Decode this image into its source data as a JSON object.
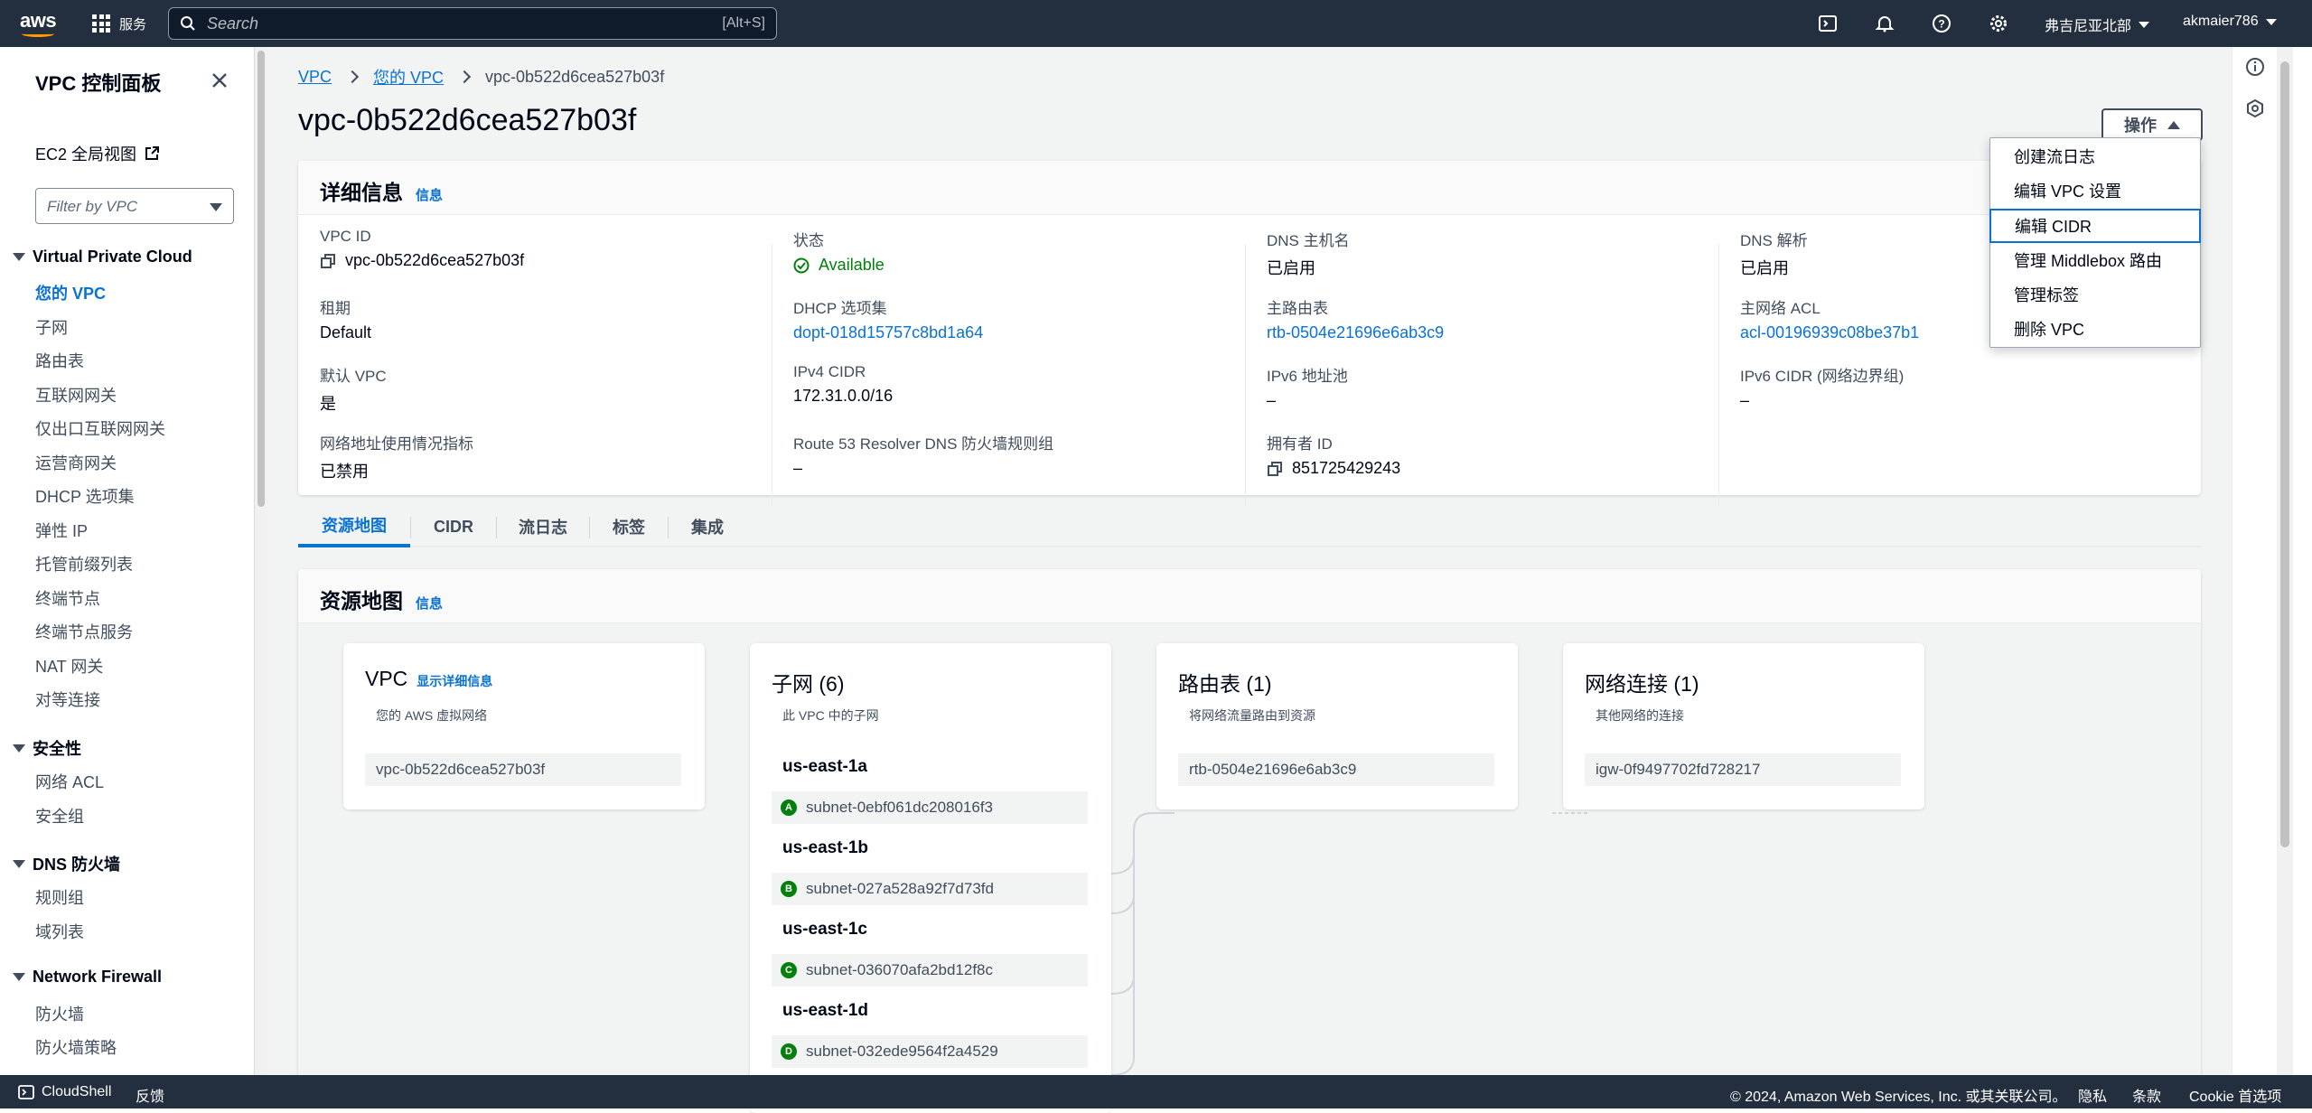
{
  "topbar": {
    "logo": "aws",
    "services_label": "服务",
    "search_placeholder": "Search",
    "search_shortcut": "[Alt+S]",
    "region": "弗吉尼亚北部",
    "user": "akmaier786",
    "icons": [
      "cloudshell-icon",
      "bell-icon",
      "help-icon",
      "settings-icon"
    ]
  },
  "sidenav": {
    "title": "VPC 控制面板",
    "ec2_link": "EC2 全局视图",
    "filter_placeholder": "Filter by VPC",
    "sections": [
      {
        "title": "Virtual Private Cloud",
        "items": [
          "您的 VPC",
          "子网",
          "路由表",
          "互联网网关",
          "仅出口互联网网关",
          "运营商网关",
          "DHCP 选项集",
          "弹性 IP",
          "托管前缀列表",
          "终端节点",
          "终端节点服务",
          "NAT 网关",
          "对等连接"
        ]
      },
      {
        "title": "安全性",
        "items": [
          "网络 ACL",
          "安全组"
        ]
      },
      {
        "title": "DNS 防火墙",
        "items": [
          "规则组",
          "域列表"
        ]
      },
      {
        "title": "Network Firewall",
        "items": [
          "防火墙",
          "防火墙策略"
        ]
      }
    ],
    "active_item": "您的 VPC"
  },
  "breadcrumb": {
    "items": [
      "VPC",
      "您的 VPC",
      "vpc-0b522d6cea527b03f"
    ]
  },
  "page_title": "vpc-0b522d6cea527b03f",
  "actions_label": "操作",
  "actions_menu": [
    "创建流日志",
    "编辑 VPC 设置",
    "编辑 CIDR",
    "管理 Middlebox 路由",
    "管理标签",
    "删除 VPC"
  ],
  "actions_focused": "编辑 CIDR",
  "details": {
    "title": "详细信息",
    "info": "信息",
    "fields": [
      {
        "label": "VPC ID",
        "value": "vpc-0b522d6cea527b03f"
      },
      {
        "label": "状态",
        "value": "Available"
      },
      {
        "label": "DNS 主机名",
        "value": "已启用"
      },
      {
        "label": "DNS 解析",
        "value": "已启用"
      },
      {
        "label": "租期",
        "value": "Default"
      },
      {
        "label": "DHCP 选项集",
        "value": "dopt-018d15757c8bd1a64"
      },
      {
        "label": "主路由表",
        "value": "rtb-0504e21696e6ab3c9"
      },
      {
        "label": "主网络 ACL",
        "value": "acl-00196939c08be37b1"
      },
      {
        "label": "默认 VPC",
        "value": "是"
      },
      {
        "label": "IPv4 CIDR",
        "value": "172.31.0.0/16"
      },
      {
        "label": "IPv6 地址池",
        "value": "–"
      },
      {
        "label": "IPv6 CIDR (网络边界组)",
        "value": "–"
      },
      {
        "label": "网络地址使用情况指标",
        "value": "已禁用"
      },
      {
        "label": "Route 53 Resolver DNS 防火墙规则组",
        "value": "–"
      },
      {
        "label": "拥有者 ID",
        "value": "851725429243"
      }
    ]
  },
  "tabs": [
    "资源地图",
    "CIDR",
    "流日志",
    "标签",
    "集成"
  ],
  "active_tab": "资源地图",
  "resource_map": {
    "title": "资源地图",
    "info": "信息",
    "vpc": {
      "title": "VPC",
      "link": "显示详细信息",
      "subtitle": "您的 AWS 虚拟网络",
      "value": "vpc-0b522d6cea527b03f"
    },
    "subnets": {
      "title": "子网 (6)",
      "subtitle": "此 VPC 中的子网",
      "zones": [
        {
          "az": "us-east-1a",
          "badge": "A",
          "subnet": "subnet-0ebf061dc208016f3"
        },
        {
          "az": "us-east-1b",
          "badge": "B",
          "subnet": "subnet-027a528a92f7d73fd"
        },
        {
          "az": "us-east-1c",
          "badge": "C",
          "subnet": "subnet-036070afa2bd12f8c"
        },
        {
          "az": "us-east-1d",
          "badge": "D",
          "subnet": "subnet-032ede9564f2a4529"
        }
      ]
    },
    "route_tables": {
      "title": "路由表 (1)",
      "subtitle": "将网络流量路由到资源",
      "value": "rtb-0504e21696e6ab3c9"
    },
    "connections": {
      "title": "网络连接 (1)",
      "subtitle": "其他网络的连接",
      "value": "igw-0f9497702fd728217"
    }
  },
  "footer": {
    "cloudshell": "CloudShell",
    "feedback": "反馈",
    "copyright": "© 2024, Amazon Web Services, Inc. 或其关联公司。",
    "privacy": "隐私",
    "terms": "条款",
    "cookies": "Cookie 首选项"
  },
  "colors": {
    "topbar": "#232f3e",
    "link": "#0972d3",
    "success": "#037f0c",
    "brand": "#ff9900"
  }
}
